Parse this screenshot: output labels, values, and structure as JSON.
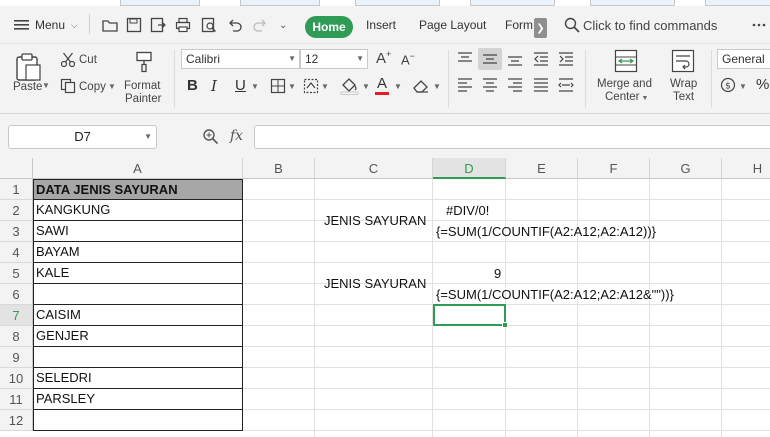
{
  "menubar": {
    "menu_label": "Menu",
    "tabs": [
      {
        "label": "Home",
        "active": true
      },
      {
        "label": "Insert"
      },
      {
        "label": "Page Layout"
      },
      {
        "label": "Form"
      }
    ],
    "search_placeholder": "Click to find commands"
  },
  "ribbon": {
    "paste_label": "Paste",
    "cut_label": "Cut",
    "copy_label": "Copy",
    "format_painter_label_1": "Format",
    "format_painter_label_2": "Painter",
    "font_name": "Calibri",
    "font_size": "12",
    "merge_label_1": "Merge and",
    "merge_label_2": "Center",
    "wrap_label_1": "Wrap",
    "wrap_label_2": "Text",
    "number_format": "General",
    "accent_color": "#2f9b54",
    "font_color_bar": "#e02020"
  },
  "formula_bar": {
    "name_box": "D7",
    "fx_label": "fx",
    "formula": ""
  },
  "sheet": {
    "columns": [
      "A",
      "B",
      "C",
      "D",
      "E",
      "F",
      "G",
      "H"
    ],
    "rows": [
      "1",
      "2",
      "3",
      "4",
      "5",
      "6",
      "7",
      "8",
      "9",
      "10",
      "11",
      "12"
    ],
    "selected_column": "D",
    "selected_row": "7",
    "column_a": [
      "DATA JENIS SAYURAN",
      "KANGKUNG",
      "SAWI",
      "BAYAM",
      "KALE",
      "",
      "CAISIM",
      "GENJER",
      "",
      "SELEDRI",
      "PARSLEY",
      ""
    ],
    "c2_label": "JENIS SAYURAN",
    "c5_label": "JENIS SAYURAN",
    "d2_value": "#DIV/0!",
    "d3_formula": "{=SUM(1/COUNTIF(A2:A12;A2:A12))}",
    "d5_value": "9",
    "d6_formula": "{=SUM(1/COUNTIF(A2:A12;A2:A12&\"\"))}"
  }
}
